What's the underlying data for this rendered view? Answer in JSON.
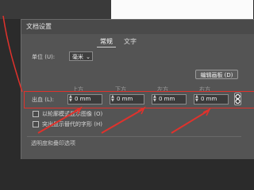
{
  "dialog": {
    "title": "文档设置",
    "tabs": [
      {
        "label": "常规"
      },
      {
        "label": "文字"
      }
    ],
    "units_label": "单位 (U):",
    "units_value": "毫米",
    "edit_artboard_button": "编辑画板 (D)",
    "bleed_label": "出血 (L):",
    "edge_headers": [
      "上方",
      "下方",
      "左方",
      "右方"
    ],
    "bleed_values": [
      "0 mm",
      "0 mm",
      "0 mm",
      "0 mm"
    ],
    "checkboxes": [
      {
        "label": "以轮廓模式显示图像 (O)"
      },
      {
        "label": "突出显示替代的字形 (H)"
      }
    ],
    "section_title": "透明度和叠印选项"
  },
  "colors": {
    "annotation": "#e0322c",
    "dialog_bg": "#545454"
  },
  "icons": {
    "link": "link-icon",
    "dropdown": "chevron-down-icon",
    "spinner": "spinner-icon"
  }
}
